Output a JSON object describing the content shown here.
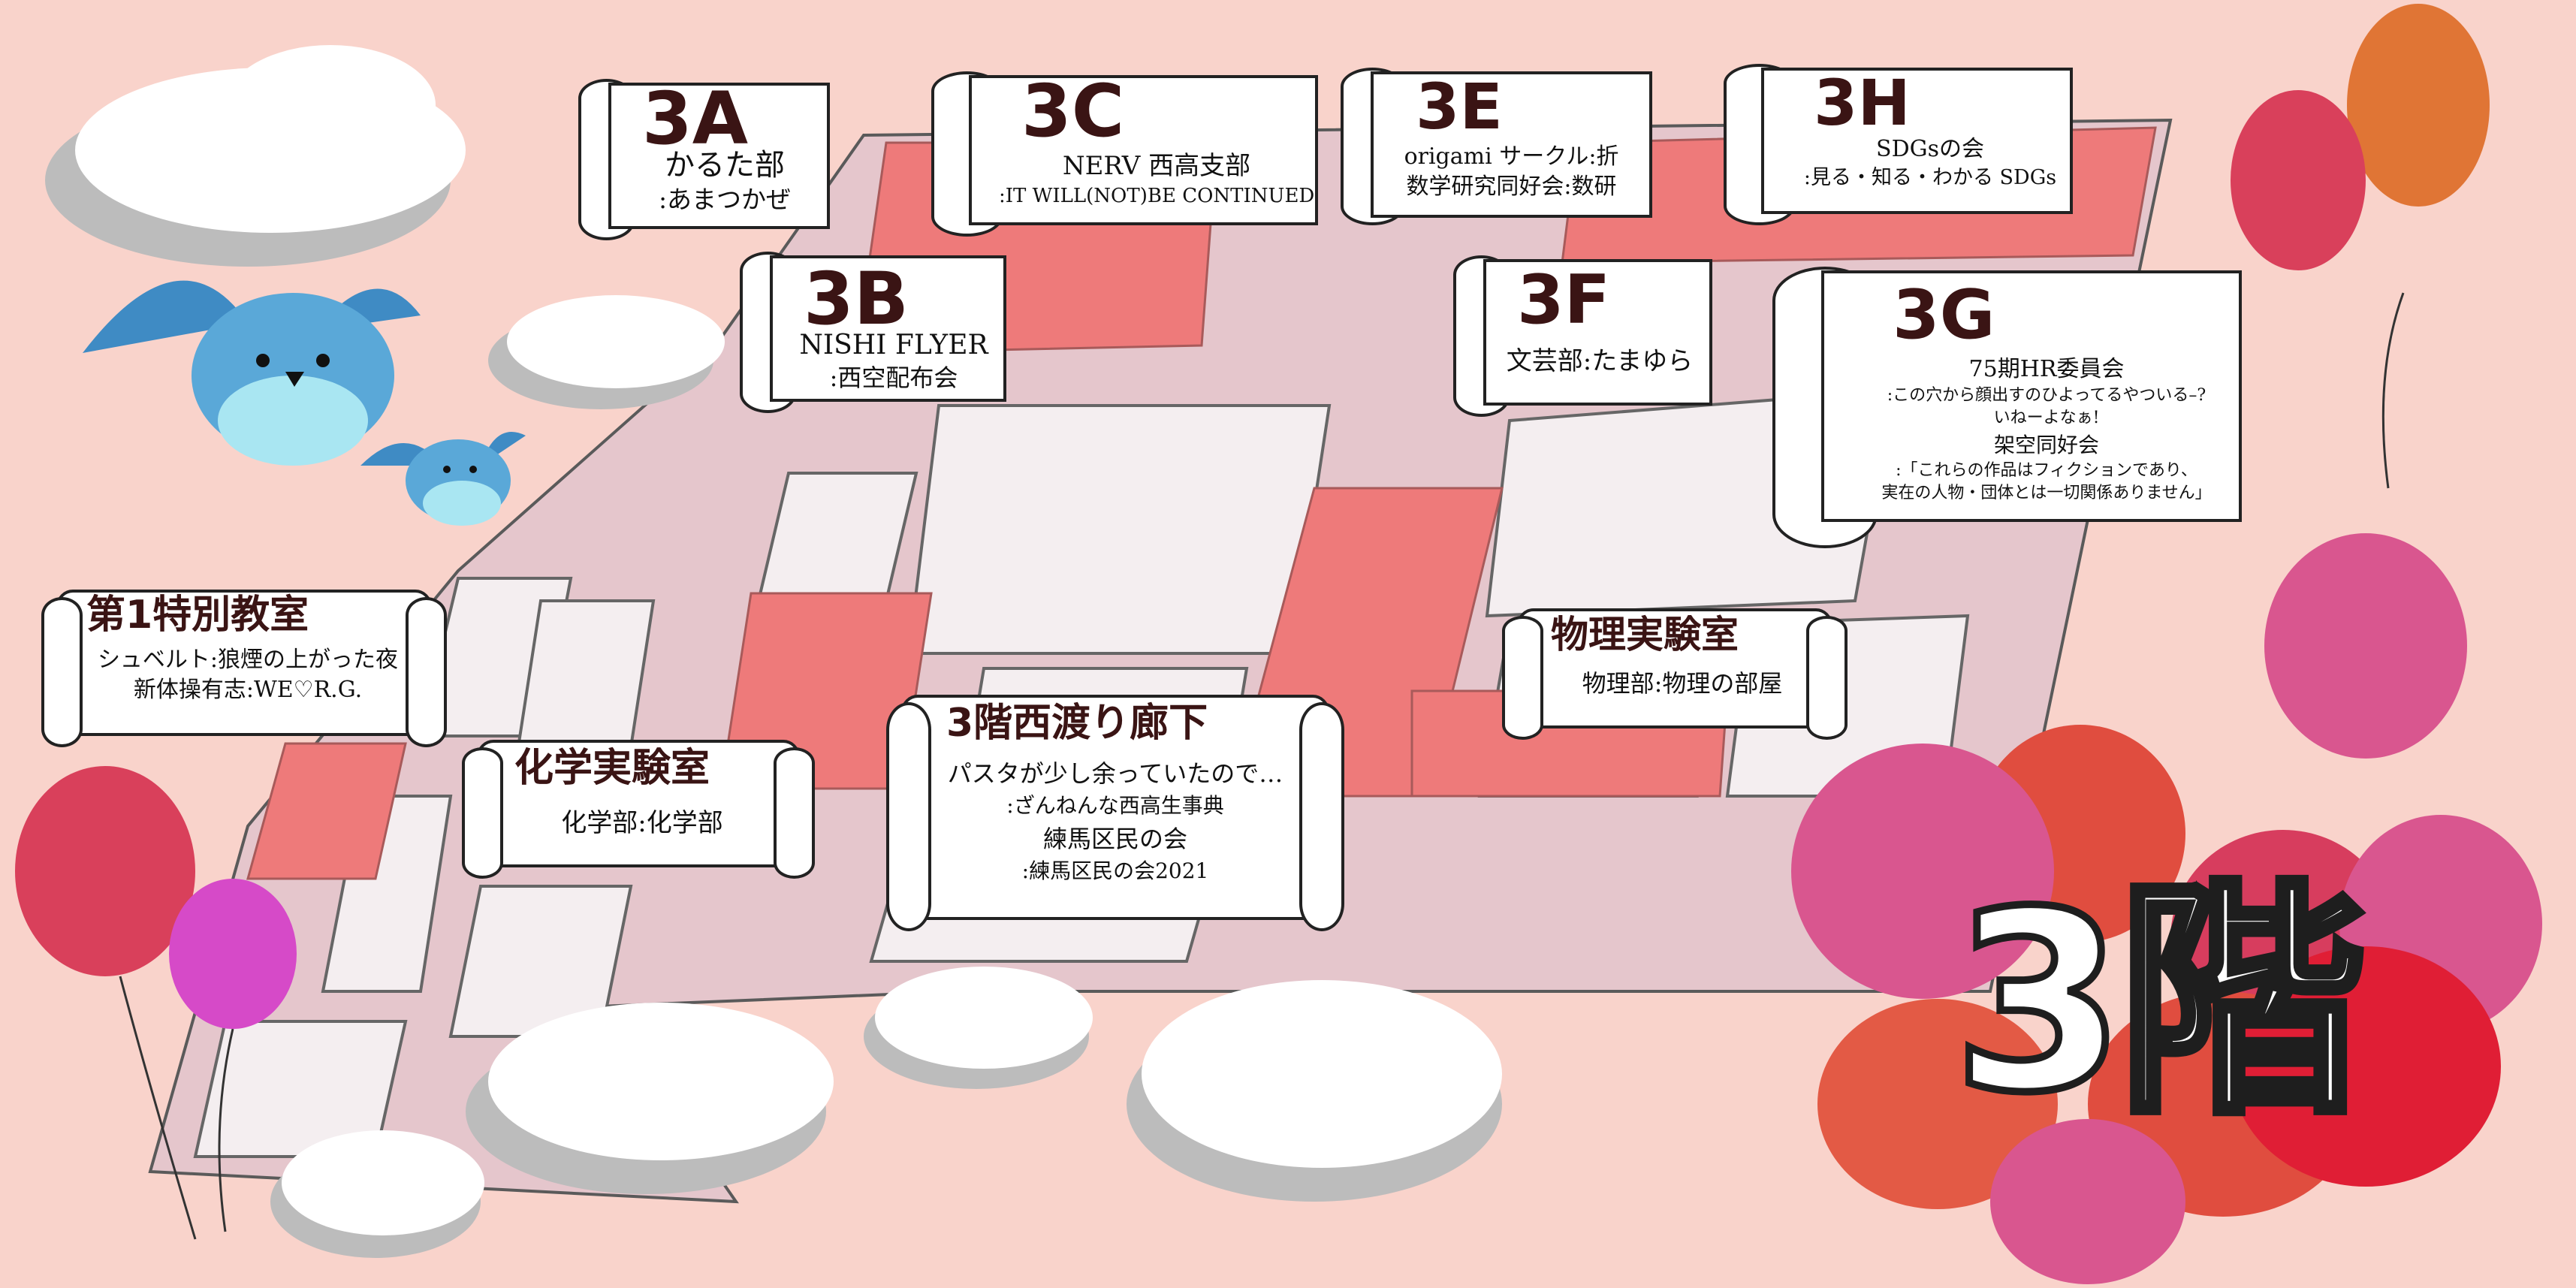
{
  "floor_label": "3階",
  "rooms": {
    "r3A": {
      "code": "3A",
      "lines": [
        "かるた部",
        ":あまつかぜ"
      ]
    },
    "r3C": {
      "code": "3C",
      "lines": [
        "NERV 西高支部",
        ":IT WILL(NOT)BE CONTINUED"
      ]
    },
    "r3E": {
      "code": "3E",
      "lines": [
        "origami サークル:折",
        "数学研究同好会:数研"
      ]
    },
    "r3H": {
      "code": "3H",
      "lines": [
        "SDGsの会",
        ":見る・知る・わかる SDGs"
      ]
    },
    "r3B": {
      "code": "3B",
      "lines": [
        "NISHI FLYER",
        ":西空配布会"
      ]
    },
    "r3F": {
      "code": "3F",
      "lines": [
        "文芸部:たまゆら"
      ]
    },
    "r3G": {
      "code": "3G",
      "lines": [
        "75期HR委員会",
        ":この穴から顔出すのひよってるやついる–?",
        "いねーよなぁ!",
        "架空同好会",
        ":「これらの作品はフィクションであり、",
        "実在の人物・団体とは一切関係ありません」"
      ]
    },
    "special1": {
      "title": "第1特別教室",
      "lines": [
        "シュベルト:狼煙の上がった夜",
        "新体操有志:WE♡R.G."
      ]
    },
    "chem": {
      "title": "化学実験室",
      "lines": [
        "化学部:化学部"
      ]
    },
    "corridor": {
      "title": "3階西渡り廊下",
      "lines": [
        "パスタが少し余っていたので…",
        ":ざんねんな西高生事典",
        "練馬区民の会",
        ":練馬区民の会2021"
      ]
    },
    "physics": {
      "title": "物理実験室",
      "lines": [
        "物理部:物理の部屋"
      ]
    }
  },
  "colors": {
    "background": "#f9d3cb",
    "floor": "#e5c6cc",
    "wall": "#f4f0f1",
    "highlight": "#ee7a7a",
    "bird": "#5aa8d8",
    "text_dark": "#3a1414"
  },
  "icons": [
    "cloud-icon",
    "bird-icon",
    "balloon-icon",
    "scroll-icon"
  ]
}
